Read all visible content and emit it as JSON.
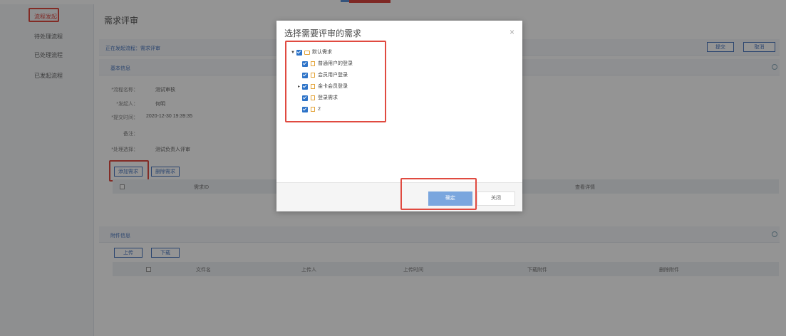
{
  "sidebar": {
    "items": [
      {
        "label": "流程发起",
        "active": true
      },
      {
        "label": "待处理流程",
        "active": false
      },
      {
        "label": "已处理流程",
        "active": false
      },
      {
        "label": "已发起流程",
        "active": false
      }
    ]
  },
  "page": {
    "title": "需求评审",
    "process_bar": "正在发起流程：需求评审",
    "action_buttons": [
      "提交",
      "取消"
    ]
  },
  "basic_info": {
    "section_title": "基本信息",
    "fields": [
      {
        "label": "*流程名称：",
        "value": "测试审核"
      },
      {
        "label": "*发起人：",
        "value": "何明"
      },
      {
        "label": "*提交时间：",
        "value": "2020-12-30 19:39:35"
      },
      {
        "label": "备注：",
        "value": ""
      },
      {
        "label": "*处理选择：",
        "value": "测试负责人评审"
      }
    ],
    "buttons": {
      "add": "添加需求",
      "delete": "删除需求"
    },
    "table_headers": [
      "需求ID",
      "查看详情"
    ]
  },
  "attachment": {
    "section_title": "附件信息",
    "buttons": {
      "upload": "上传",
      "download": "下载"
    },
    "table_headers": [
      "文件名",
      "上传人",
      "上传时间",
      "下载附件",
      "删除附件"
    ]
  },
  "modal": {
    "title": "选择需要评审的需求",
    "close": "×",
    "tree": [
      {
        "label": "默认需求",
        "level": 0,
        "expanded": true,
        "folder": true
      },
      {
        "label": "普通用户的登录",
        "level": 1
      },
      {
        "label": "会员用户登录",
        "level": 1
      },
      {
        "label": "金卡会员登录",
        "level": 1,
        "collapsed": true
      },
      {
        "label": "登录需求",
        "level": 1
      },
      {
        "label": "2",
        "level": 1
      }
    ],
    "confirm": "确定",
    "close_label": "关闭"
  },
  "colors": {
    "accent": "#4a78c0",
    "highlight": "#e04a40",
    "primary_btn": "#7aa6de"
  }
}
